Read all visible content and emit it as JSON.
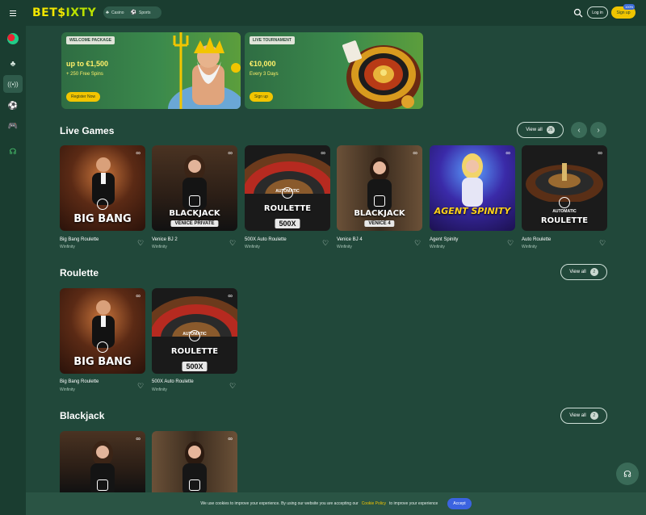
{
  "topbar": {
    "logo_part1": "BET$",
    "logo_part2": "IXTY",
    "casino_label": "Casino",
    "sports_label": "Sports",
    "login_label": "Log in",
    "signup_label": "Sign up",
    "signup_badge": "100%"
  },
  "promos": [
    {
      "tag": "WELCOME PACKAGE",
      "headline": "up to €1,500",
      "sub": "+ 250 Free Spins",
      "cta": "Register Now"
    },
    {
      "tag": "LIVE TOURNAMENT",
      "headline": "€10,000",
      "sub": "Every 3 Days",
      "cta": "Sign up"
    }
  ],
  "live_games": {
    "title": "Live Games",
    "view_all": "View all",
    "count": "26",
    "items": [
      {
        "name": "Big Bang Roulette",
        "provider": "Winfinity",
        "art": "BIG BANG",
        "art_sub": ""
      },
      {
        "name": "Venice BJ 2",
        "provider": "Winfinity",
        "art": "BLACKJACK",
        "art_sub": "VENICE PRIVATE"
      },
      {
        "name": "500X Auto Roulette",
        "provider": "Winfinity",
        "art": "ROULETTE",
        "art_sub": "500X"
      },
      {
        "name": "Venice BJ 4",
        "provider": "Winfinity",
        "art": "BLACKJACK",
        "art_sub": "VENICE 4"
      },
      {
        "name": "Agent Spinity",
        "provider": "Winfinity",
        "art": "AGENT SPINITY",
        "art_sub": ""
      },
      {
        "name": "Auto Roulette",
        "provider": "Winfinity",
        "art": "ROULETTE",
        "art_sub": ""
      }
    ]
  },
  "roulette": {
    "title": "Roulette",
    "view_all": "View all",
    "count": "2",
    "items": [
      {
        "name": "Big Bang Roulette",
        "provider": "Winfinity",
        "art": "BIG BANG",
        "art_sub": ""
      },
      {
        "name": "500X Auto Roulette",
        "provider": "Winfinity",
        "art": "ROULETTE",
        "art_sub": "500X"
      }
    ]
  },
  "blackjack": {
    "title": "Blackjack",
    "view_all": "View all",
    "count": "2"
  },
  "tile_texts": {
    "automatic": "AUTOMATIC"
  },
  "cookie": {
    "text_before": "We use cookies to improve your experience. By using our website you are accepting our",
    "policy_link": "Cookie Policy",
    "text_after": "to improve your experience",
    "accept": "Accept"
  },
  "colors": {
    "background": "#21483a",
    "accent_yellow": "#efc400",
    "accept_blue": "#3b63e0"
  }
}
